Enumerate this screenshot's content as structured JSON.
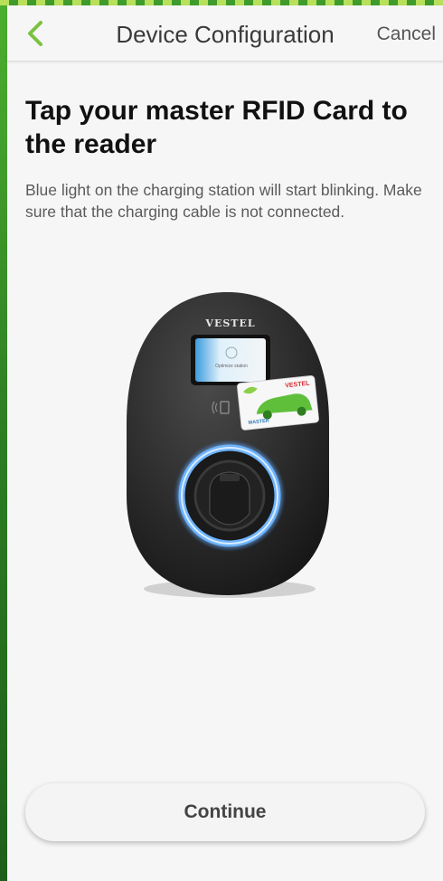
{
  "header": {
    "title": "Device Configuration",
    "cancel_label": "Cancel",
    "back_icon": "chevron-left-icon",
    "accent_color": "#7cc242"
  },
  "main": {
    "headline": "Tap your master RFID Card to the reader",
    "description": "Blue light on the charging station will start blinking. Make sure that the charging cable is not connected.",
    "illustration": {
      "brand": "VESTEL",
      "screen_text": "Optimize station",
      "card_brand": "VESTEL",
      "card_label": "MASTER"
    }
  },
  "footer": {
    "continue_label": "Continue"
  }
}
